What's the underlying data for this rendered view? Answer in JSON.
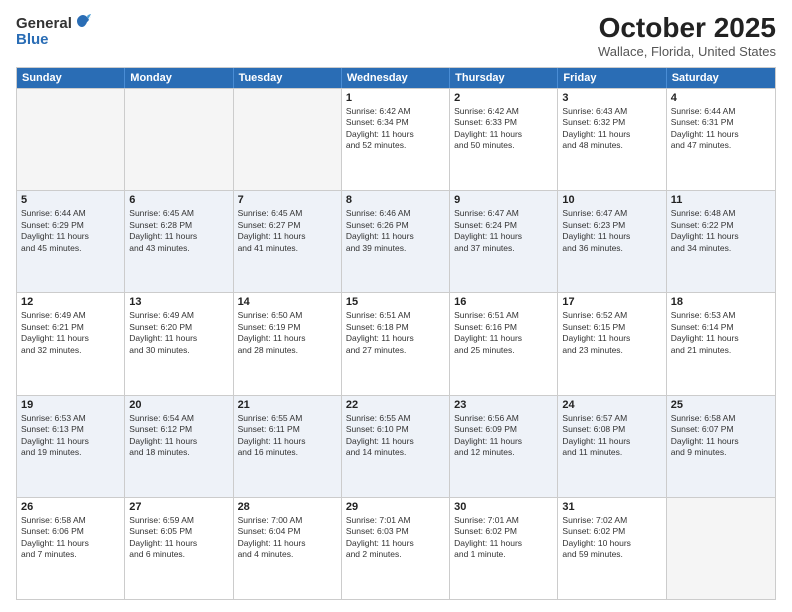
{
  "logo": {
    "general": "General",
    "blue": "Blue"
  },
  "title": "October 2025",
  "subtitle": "Wallace, Florida, United States",
  "header_days": [
    "Sunday",
    "Monday",
    "Tuesday",
    "Wednesday",
    "Thursday",
    "Friday",
    "Saturday"
  ],
  "rows": [
    {
      "alt": false,
      "cells": [
        {
          "empty": true,
          "day": "",
          "lines": []
        },
        {
          "empty": true,
          "day": "",
          "lines": []
        },
        {
          "empty": true,
          "day": "",
          "lines": []
        },
        {
          "empty": false,
          "day": "1",
          "lines": [
            "Sunrise: 6:42 AM",
            "Sunset: 6:34 PM",
            "Daylight: 11 hours",
            "and 52 minutes."
          ]
        },
        {
          "empty": false,
          "day": "2",
          "lines": [
            "Sunrise: 6:42 AM",
            "Sunset: 6:33 PM",
            "Daylight: 11 hours",
            "and 50 minutes."
          ]
        },
        {
          "empty": false,
          "day": "3",
          "lines": [
            "Sunrise: 6:43 AM",
            "Sunset: 6:32 PM",
            "Daylight: 11 hours",
            "and 48 minutes."
          ]
        },
        {
          "empty": false,
          "day": "4",
          "lines": [
            "Sunrise: 6:44 AM",
            "Sunset: 6:31 PM",
            "Daylight: 11 hours",
            "and 47 minutes."
          ]
        }
      ]
    },
    {
      "alt": true,
      "cells": [
        {
          "empty": false,
          "day": "5",
          "lines": [
            "Sunrise: 6:44 AM",
            "Sunset: 6:29 PM",
            "Daylight: 11 hours",
            "and 45 minutes."
          ]
        },
        {
          "empty": false,
          "day": "6",
          "lines": [
            "Sunrise: 6:45 AM",
            "Sunset: 6:28 PM",
            "Daylight: 11 hours",
            "and 43 minutes."
          ]
        },
        {
          "empty": false,
          "day": "7",
          "lines": [
            "Sunrise: 6:45 AM",
            "Sunset: 6:27 PM",
            "Daylight: 11 hours",
            "and 41 minutes."
          ]
        },
        {
          "empty": false,
          "day": "8",
          "lines": [
            "Sunrise: 6:46 AM",
            "Sunset: 6:26 PM",
            "Daylight: 11 hours",
            "and 39 minutes."
          ]
        },
        {
          "empty": false,
          "day": "9",
          "lines": [
            "Sunrise: 6:47 AM",
            "Sunset: 6:24 PM",
            "Daylight: 11 hours",
            "and 37 minutes."
          ]
        },
        {
          "empty": false,
          "day": "10",
          "lines": [
            "Sunrise: 6:47 AM",
            "Sunset: 6:23 PM",
            "Daylight: 11 hours",
            "and 36 minutes."
          ]
        },
        {
          "empty": false,
          "day": "11",
          "lines": [
            "Sunrise: 6:48 AM",
            "Sunset: 6:22 PM",
            "Daylight: 11 hours",
            "and 34 minutes."
          ]
        }
      ]
    },
    {
      "alt": false,
      "cells": [
        {
          "empty": false,
          "day": "12",
          "lines": [
            "Sunrise: 6:49 AM",
            "Sunset: 6:21 PM",
            "Daylight: 11 hours",
            "and 32 minutes."
          ]
        },
        {
          "empty": false,
          "day": "13",
          "lines": [
            "Sunrise: 6:49 AM",
            "Sunset: 6:20 PM",
            "Daylight: 11 hours",
            "and 30 minutes."
          ]
        },
        {
          "empty": false,
          "day": "14",
          "lines": [
            "Sunrise: 6:50 AM",
            "Sunset: 6:19 PM",
            "Daylight: 11 hours",
            "and 28 minutes."
          ]
        },
        {
          "empty": false,
          "day": "15",
          "lines": [
            "Sunrise: 6:51 AM",
            "Sunset: 6:18 PM",
            "Daylight: 11 hours",
            "and 27 minutes."
          ]
        },
        {
          "empty": false,
          "day": "16",
          "lines": [
            "Sunrise: 6:51 AM",
            "Sunset: 6:16 PM",
            "Daylight: 11 hours",
            "and 25 minutes."
          ]
        },
        {
          "empty": false,
          "day": "17",
          "lines": [
            "Sunrise: 6:52 AM",
            "Sunset: 6:15 PM",
            "Daylight: 11 hours",
            "and 23 minutes."
          ]
        },
        {
          "empty": false,
          "day": "18",
          "lines": [
            "Sunrise: 6:53 AM",
            "Sunset: 6:14 PM",
            "Daylight: 11 hours",
            "and 21 minutes."
          ]
        }
      ]
    },
    {
      "alt": true,
      "cells": [
        {
          "empty": false,
          "day": "19",
          "lines": [
            "Sunrise: 6:53 AM",
            "Sunset: 6:13 PM",
            "Daylight: 11 hours",
            "and 19 minutes."
          ]
        },
        {
          "empty": false,
          "day": "20",
          "lines": [
            "Sunrise: 6:54 AM",
            "Sunset: 6:12 PM",
            "Daylight: 11 hours",
            "and 18 minutes."
          ]
        },
        {
          "empty": false,
          "day": "21",
          "lines": [
            "Sunrise: 6:55 AM",
            "Sunset: 6:11 PM",
            "Daylight: 11 hours",
            "and 16 minutes."
          ]
        },
        {
          "empty": false,
          "day": "22",
          "lines": [
            "Sunrise: 6:55 AM",
            "Sunset: 6:10 PM",
            "Daylight: 11 hours",
            "and 14 minutes."
          ]
        },
        {
          "empty": false,
          "day": "23",
          "lines": [
            "Sunrise: 6:56 AM",
            "Sunset: 6:09 PM",
            "Daylight: 11 hours",
            "and 12 minutes."
          ]
        },
        {
          "empty": false,
          "day": "24",
          "lines": [
            "Sunrise: 6:57 AM",
            "Sunset: 6:08 PM",
            "Daylight: 11 hours",
            "and 11 minutes."
          ]
        },
        {
          "empty": false,
          "day": "25",
          "lines": [
            "Sunrise: 6:58 AM",
            "Sunset: 6:07 PM",
            "Daylight: 11 hours",
            "and 9 minutes."
          ]
        }
      ]
    },
    {
      "alt": false,
      "cells": [
        {
          "empty": false,
          "day": "26",
          "lines": [
            "Sunrise: 6:58 AM",
            "Sunset: 6:06 PM",
            "Daylight: 11 hours",
            "and 7 minutes."
          ]
        },
        {
          "empty": false,
          "day": "27",
          "lines": [
            "Sunrise: 6:59 AM",
            "Sunset: 6:05 PM",
            "Daylight: 11 hours",
            "and 6 minutes."
          ]
        },
        {
          "empty": false,
          "day": "28",
          "lines": [
            "Sunrise: 7:00 AM",
            "Sunset: 6:04 PM",
            "Daylight: 11 hours",
            "and 4 minutes."
          ]
        },
        {
          "empty": false,
          "day": "29",
          "lines": [
            "Sunrise: 7:01 AM",
            "Sunset: 6:03 PM",
            "Daylight: 11 hours",
            "and 2 minutes."
          ]
        },
        {
          "empty": false,
          "day": "30",
          "lines": [
            "Sunrise: 7:01 AM",
            "Sunset: 6:02 PM",
            "Daylight: 11 hours",
            "and 1 minute."
          ]
        },
        {
          "empty": false,
          "day": "31",
          "lines": [
            "Sunrise: 7:02 AM",
            "Sunset: 6:02 PM",
            "Daylight: 10 hours",
            "and 59 minutes."
          ]
        },
        {
          "empty": true,
          "day": "",
          "lines": []
        }
      ]
    }
  ]
}
